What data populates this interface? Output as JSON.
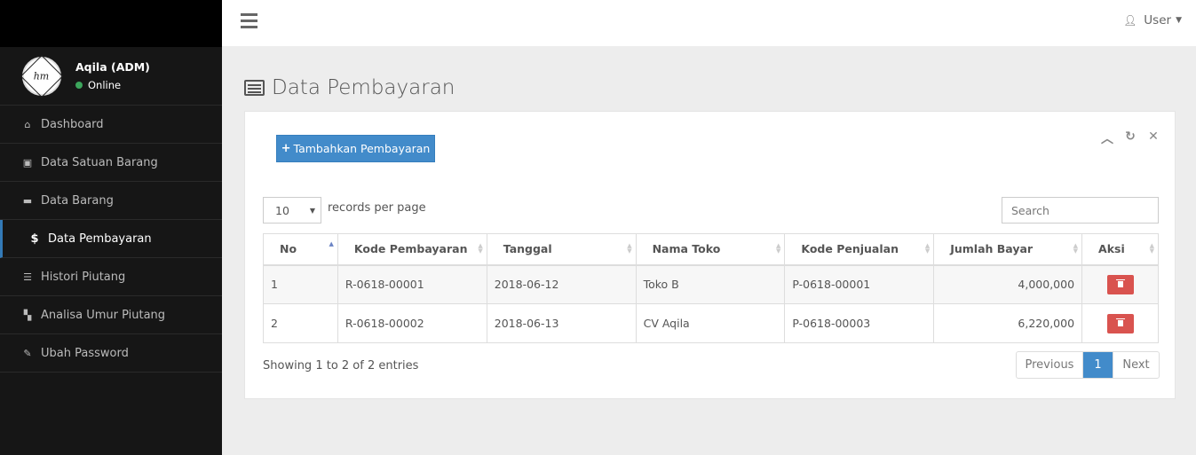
{
  "user": {
    "name": "Aqila (ADM)",
    "status": "Online",
    "avatar_text": "hm"
  },
  "sidebar": {
    "items": [
      {
        "label": "Dashboard",
        "icon": "home-icon",
        "glyph": "⌂"
      },
      {
        "label": "Data Satuan Barang",
        "icon": "briefcase-icon",
        "glyph": "▣"
      },
      {
        "label": "Data Barang",
        "icon": "truck-icon",
        "glyph": "▬"
      },
      {
        "label": "Data Pembayaran",
        "icon": "dollar-icon",
        "glyph": "$",
        "active": true
      },
      {
        "label": "Histori Piutang",
        "icon": "list-icon",
        "glyph": "☰"
      },
      {
        "label": "Analisa Umur Piutang",
        "icon": "sitemap-icon",
        "glyph": "▚"
      },
      {
        "label": "Ubah Password",
        "icon": "pencil-icon",
        "glyph": "✎"
      }
    ]
  },
  "header": {
    "user_label": "User"
  },
  "page": {
    "title": "Data Pembayaran"
  },
  "panel": {
    "add_button": "Tambahkan Pembayaran",
    "records_per_page_value": "10",
    "records_per_page_label": "records per page",
    "search_placeholder": "Search",
    "columns": [
      "No",
      "Kode Pembayaran",
      "Tanggal",
      "Nama Toko",
      "Kode Penjualan",
      "Jumlah Bayar",
      "Aksi"
    ],
    "rows": [
      {
        "no": "1",
        "kode_pembayaran": "R-0618-00001",
        "tanggal": "2018-06-12",
        "nama_toko": "Toko B",
        "kode_penjualan": "P-0618-00001",
        "jumlah_bayar": "4,000,000"
      },
      {
        "no": "2",
        "kode_pembayaran": "R-0618-00002",
        "tanggal": "2018-06-13",
        "nama_toko": "CV Aqila",
        "kode_penjualan": "P-0618-00003",
        "jumlah_bayar": "6,220,000"
      }
    ],
    "info": "Showing 1 to 2 of 2 entries",
    "pagination": {
      "previous": "Previous",
      "current": "1",
      "next": "Next"
    }
  },
  "colors": {
    "primary": "#428bca",
    "danger": "#d9534f",
    "sidebar": "#161616",
    "online": "#3ca55c"
  }
}
